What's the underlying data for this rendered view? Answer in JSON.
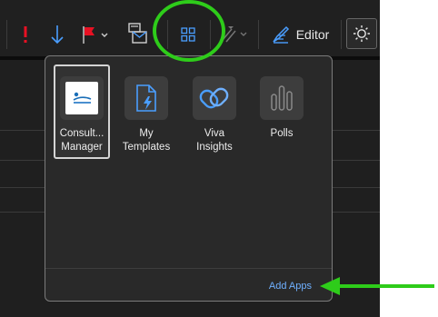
{
  "toolbar": {
    "editor_label": "Editor"
  },
  "flyout": {
    "apps": [
      {
        "name": "consultant-manager",
        "label": "Consult...\nManager",
        "icon": "consultant-manager-logo-icon",
        "selected": true
      },
      {
        "name": "my-templates",
        "label": "My\nTemplates",
        "icon": "templates-icon",
        "selected": false
      },
      {
        "name": "viva-insights",
        "label": "Viva\nInsights",
        "icon": "viva-insights-icon",
        "selected": false
      },
      {
        "name": "polls",
        "label": "Polls",
        "icon": "polls-icon",
        "selected": false
      }
    ],
    "add_apps_label": "Add Apps"
  },
  "colors": {
    "toolbar_bg": "#202020",
    "flyout_bg": "#292929",
    "accent_blue": "#4a9eff",
    "link_blue": "#6fb0ff",
    "annotation_green": "#2ecc1a",
    "flag_red": "#e81123"
  }
}
